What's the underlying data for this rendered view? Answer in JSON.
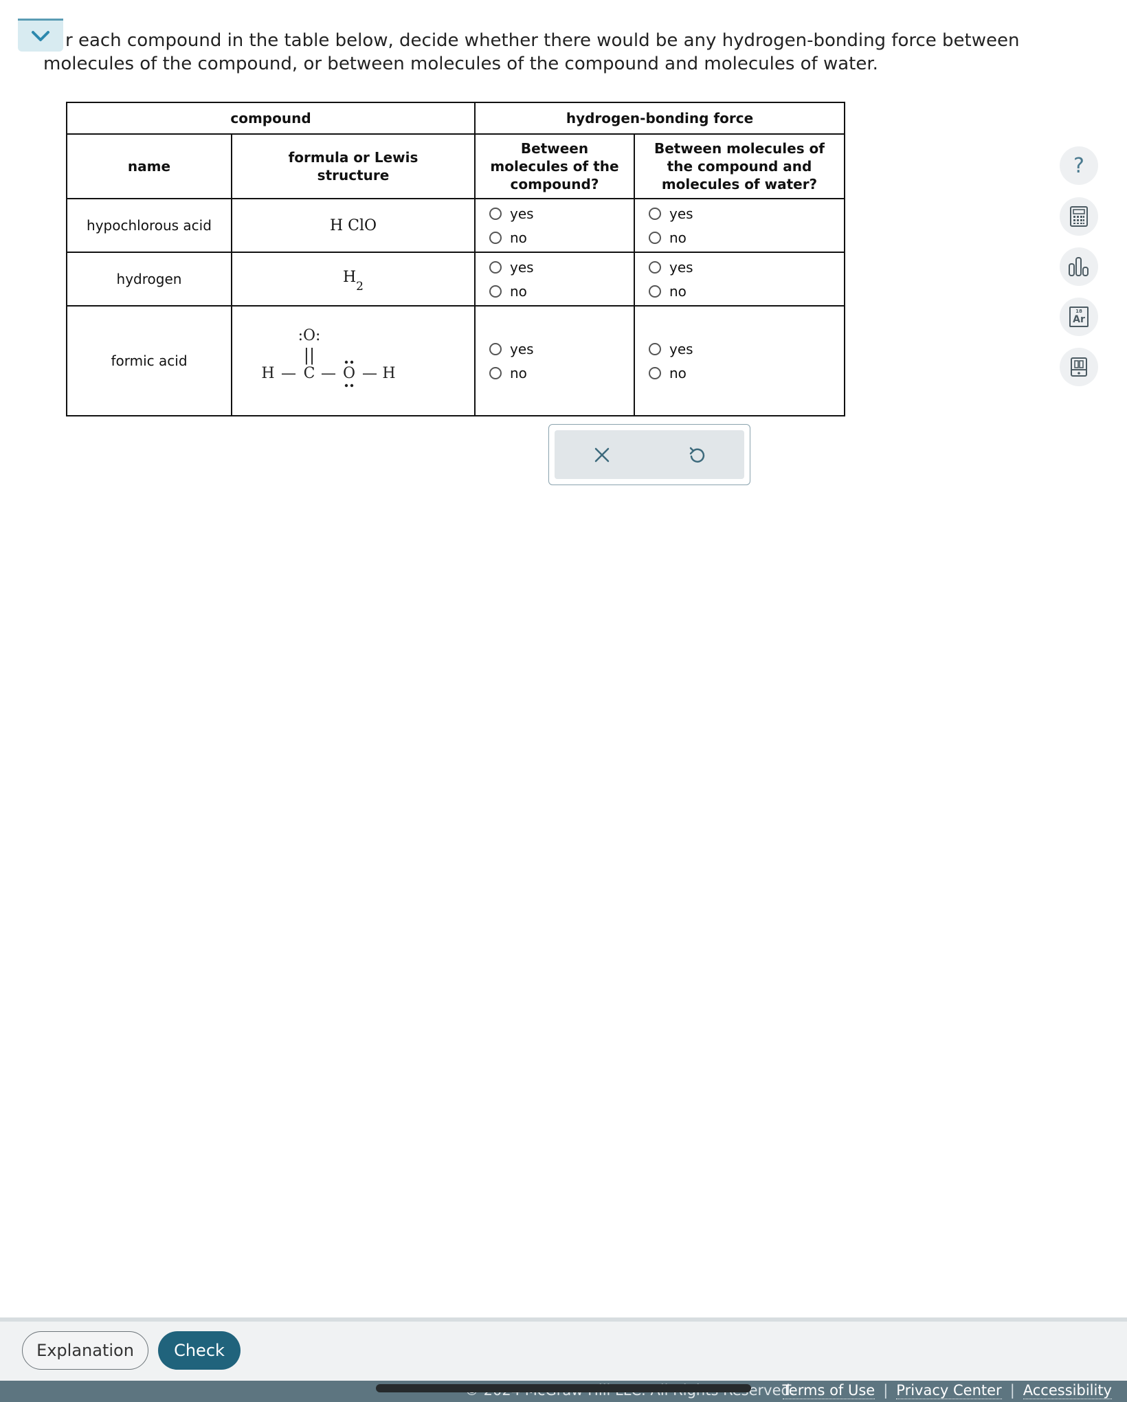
{
  "question": {
    "line1": "r each compound in the table below, decide whether there would be any hydrogen-bonding force between",
    "line2": "molecules of the compound, or between molecules of the compound and molecules of water."
  },
  "table": {
    "group_compound": "compound",
    "group_force": "hydrogen-bonding force",
    "col_name": "name",
    "col_formula": "formula or Lewis structure",
    "col_between_compound": "Between molecules of the compound?",
    "col_between_water": "Between molecules of the compound and molecules of water?",
    "rows": [
      {
        "name": "hypochlorous acid",
        "formula": "H ClO"
      },
      {
        "name": "hydrogen",
        "formula_main": "H",
        "formula_sub": "2"
      },
      {
        "name": "formic acid",
        "lewis": {
          "h_left": "H",
          "c": "C",
          "o_top": ":O:",
          "o_right": "O",
          "h_right": "H",
          "bond": "—",
          "double_bond": "||"
        }
      }
    ],
    "option_yes": "yes",
    "option_no": "no"
  },
  "actions": {
    "clear_icon": "x-icon",
    "undo_icon": "undo-icon"
  },
  "tools": [
    "help-icon",
    "calculator-icon",
    "bar-chart-icon",
    "periodic-table-icon",
    "reference-book-icon"
  ],
  "tool_labels": {
    "help": "?",
    "periodic": "Ar",
    "periodic_num": "18"
  },
  "footer": {
    "explanation_label": "Explanation",
    "check_label": "Check",
    "copyright": "© 2024 McGraw Hill LLC. All Rights Reserved.",
    "terms": "Terms of Use",
    "privacy": "Privacy Center",
    "accessibility": "Accessibility",
    "separator": "|"
  },
  "colors": {
    "accent": "#20637c",
    "collapse_bg": "#d8ebf1",
    "legal_bar": "#5d7580"
  }
}
